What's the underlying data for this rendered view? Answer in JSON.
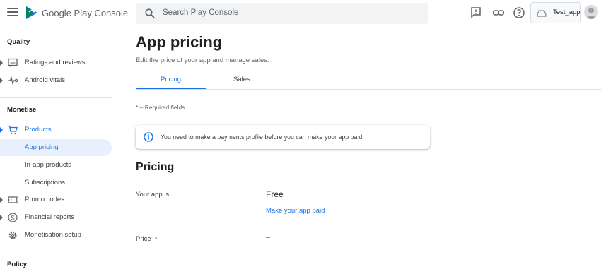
{
  "header": {
    "brand": "Google Play Console",
    "search_placeholder": "Search Play Console",
    "app_name": "Test_app"
  },
  "sidebar": {
    "sections": [
      {
        "title": "Quality"
      },
      {
        "title": "Monetise"
      },
      {
        "title": "Policy"
      }
    ],
    "items": [
      {
        "label": "Ratings and reviews",
        "icon": "rating-icon"
      },
      {
        "label": "Android vitals",
        "icon": "vitals-icon"
      },
      {
        "label": "Products",
        "icon": "cart-icon"
      },
      {
        "label": "App pricing"
      },
      {
        "label": "In-app products"
      },
      {
        "label": "Subscriptions"
      },
      {
        "label": "Promo codes",
        "icon": "ticket-icon"
      },
      {
        "label": "Financial reports",
        "icon": "dollar-icon"
      },
      {
        "label": "Monetisation setup",
        "icon": "gear-icon"
      }
    ]
  },
  "main": {
    "title": "App pricing",
    "subtitle": "Edit the price of your app and manage sales.",
    "tabs": [
      {
        "label": "Pricing"
      },
      {
        "label": "Sales"
      }
    ],
    "required_note": "* – Required fields",
    "notice": "You need to make a payments profile before you can make your app paid",
    "pricing_section": {
      "title": "Pricing",
      "your_app_label": "Your app is",
      "your_app_value": "Free",
      "make_paid_link": "Make your app paid",
      "price_label": "Price  *",
      "price_value": "–"
    }
  },
  "colors": {
    "accent": "#1a73e8",
    "active_bg": "#e8f0fe",
    "text": "#202124",
    "muted": "#5f6368"
  }
}
